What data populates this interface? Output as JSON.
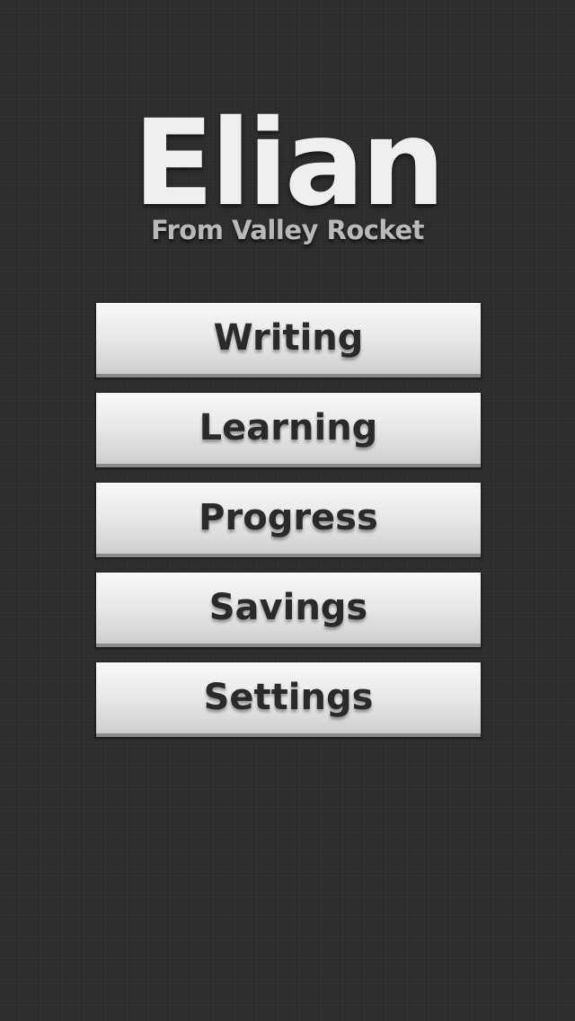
{
  "header": {
    "title": "Elian",
    "subtitle": "From Valley Rocket"
  },
  "menu": {
    "items": [
      {
        "label": "Writing"
      },
      {
        "label": "Learning"
      },
      {
        "label": "Progress"
      },
      {
        "label": "Savings"
      },
      {
        "label": "Settings"
      }
    ]
  },
  "colors": {
    "background": "#2d2d2d",
    "title": "#efefef",
    "subtitle": "#b9b9b9",
    "button_face": "#e9e9e9",
    "button_text": "#2a2a2a"
  }
}
